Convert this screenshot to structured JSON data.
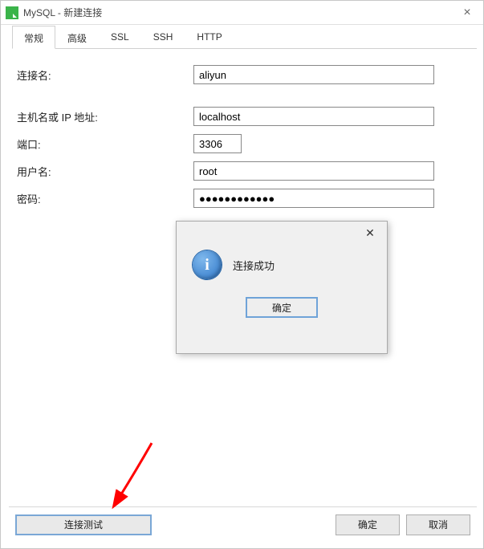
{
  "window": {
    "title": "MySQL - 新建连接"
  },
  "tabs": [
    {
      "label": "常规",
      "active": true
    },
    {
      "label": "高级",
      "active": false
    },
    {
      "label": "SSL",
      "active": false
    },
    {
      "label": "SSH",
      "active": false
    },
    {
      "label": "HTTP",
      "active": false
    }
  ],
  "form": {
    "connection_name_label": "连接名:",
    "connection_name_value": "aliyun",
    "host_label": "主机名或 IP 地址:",
    "host_value": "localhost",
    "port_label": "端口:",
    "port_value": "3306",
    "user_label": "用户名:",
    "user_value": "root",
    "password_label": "密码:",
    "password_value": "●●●●●●●●●●●●"
  },
  "footer": {
    "test_label": "连接测试",
    "ok_label": "确定",
    "cancel_label": "取消"
  },
  "modal": {
    "message": "连接成功",
    "ok_label": "确定"
  }
}
